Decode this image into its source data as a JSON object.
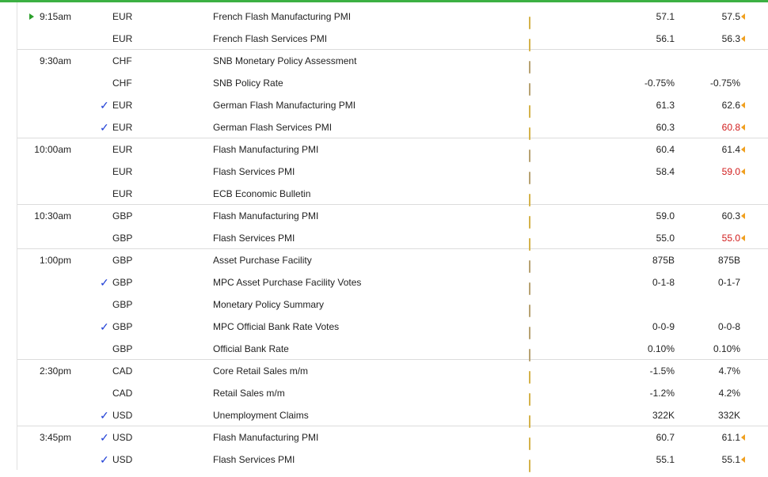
{
  "colors": {
    "accent_line": "#3cb043",
    "high_impact": "#ee1a1a",
    "medium_impact": "#f39c29",
    "low_impact": "#f3de2a",
    "worse_than_forecast": "#d11c1c",
    "check": "#1f3fd6"
  },
  "rows": [
    {
      "time": "9:15am",
      "currency": "EUR",
      "impact": "medium",
      "event": "French Flash Manufacturing PMI",
      "detail": "folder",
      "actual": "",
      "forecast": "57.1",
      "previous": "57.5",
      "previous_flag": true,
      "previous_color": "normal",
      "check": "",
      "now_marker": true,
      "group_end": false
    },
    {
      "time": "",
      "currency": "EUR",
      "impact": "medium",
      "event": "French Flash Services PMI",
      "detail": "folder",
      "actual": "",
      "forecast": "56.1",
      "previous": "56.3",
      "previous_flag": true,
      "previous_color": "normal",
      "check": "",
      "now_marker": false,
      "group_end": true
    },
    {
      "time": "9:30am",
      "currency": "CHF",
      "impact": "high",
      "event": "SNB Monetary Policy Assessment",
      "detail": "folder-open",
      "actual": "",
      "forecast": "",
      "previous": "",
      "previous_flag": false,
      "previous_color": "normal",
      "check": "",
      "now_marker": false,
      "group_end": false
    },
    {
      "time": "",
      "currency": "CHF",
      "impact": "medium",
      "event": "SNB Policy Rate",
      "detail": "folder-open",
      "actual": "",
      "forecast": "-0.75%",
      "previous": "-0.75%",
      "previous_flag": false,
      "previous_color": "normal",
      "check": "",
      "now_marker": false,
      "group_end": false
    },
    {
      "time": "",
      "currency": "EUR",
      "impact": "high",
      "event": "German Flash Manufacturing PMI",
      "detail": "folder",
      "actual": "",
      "forecast": "61.3",
      "previous": "62.6",
      "previous_flag": true,
      "previous_color": "normal",
      "check": "✓",
      "now_marker": false,
      "group_end": false
    },
    {
      "time": "",
      "currency": "EUR",
      "impact": "high",
      "event": "German Flash Services PMI",
      "detail": "folder",
      "actual": "",
      "forecast": "60.3",
      "previous": "60.8",
      "previous_flag": true,
      "previous_color": "red",
      "check": "✓",
      "now_marker": false,
      "group_end": true
    },
    {
      "time": "10:00am",
      "currency": "EUR",
      "impact": "medium",
      "event": "Flash Manufacturing PMI",
      "detail": "folder-open",
      "actual": "",
      "forecast": "60.4",
      "previous": "61.4",
      "previous_flag": true,
      "previous_color": "normal",
      "check": "",
      "now_marker": false,
      "group_end": false
    },
    {
      "time": "",
      "currency": "EUR",
      "impact": "medium",
      "event": "Flash Services PMI",
      "detail": "folder-open",
      "actual": "",
      "forecast": "58.4",
      "previous": "59.0",
      "previous_flag": true,
      "previous_color": "red",
      "check": "",
      "now_marker": false,
      "group_end": false
    },
    {
      "time": "",
      "currency": "EUR",
      "impact": "low",
      "event": "ECB Economic Bulletin",
      "detail": "folder",
      "actual": "",
      "forecast": "",
      "previous": "",
      "previous_flag": false,
      "previous_color": "normal",
      "check": "",
      "now_marker": false,
      "group_end": true
    },
    {
      "time": "10:30am",
      "currency": "GBP",
      "impact": "medium",
      "event": "Flash Manufacturing PMI",
      "detail": "folder",
      "actual": "",
      "forecast": "59.0",
      "previous": "60.3",
      "previous_flag": true,
      "previous_color": "normal",
      "check": "",
      "now_marker": false,
      "group_end": false
    },
    {
      "time": "",
      "currency": "GBP",
      "impact": "medium",
      "event": "Flash Services PMI",
      "detail": "folder",
      "actual": "",
      "forecast": "55.0",
      "previous": "55.0",
      "previous_flag": true,
      "previous_color": "red",
      "check": "",
      "now_marker": false,
      "group_end": true
    },
    {
      "time": "1:00pm",
      "currency": "GBP",
      "impact": "high",
      "event": "Asset Purchase Facility",
      "detail": "folder-open",
      "actual": "",
      "forecast": "875B",
      "previous": "875B",
      "previous_flag": false,
      "previous_color": "normal",
      "check": "",
      "now_marker": false,
      "group_end": false
    },
    {
      "time": "",
      "currency": "GBP",
      "impact": "high",
      "event": "MPC Asset Purchase Facility Votes",
      "detail": "folder-open",
      "actual": "",
      "forecast": "0-1-8",
      "previous": "0-1-7",
      "previous_flag": false,
      "previous_color": "normal",
      "check": "✓",
      "now_marker": false,
      "group_end": false
    },
    {
      "time": "",
      "currency": "GBP",
      "impact": "high",
      "event": "Monetary Policy Summary",
      "detail": "folder-open",
      "actual": "",
      "forecast": "",
      "previous": "",
      "previous_flag": false,
      "previous_color": "normal",
      "check": "",
      "now_marker": false,
      "group_end": false
    },
    {
      "time": "",
      "currency": "GBP",
      "impact": "medium",
      "event": "MPC Official Bank Rate Votes",
      "detail": "folder-open",
      "actual": "",
      "forecast": "0-0-9",
      "previous": "0-0-8",
      "previous_flag": false,
      "previous_color": "normal",
      "check": "✓",
      "now_marker": false,
      "group_end": false
    },
    {
      "time": "",
      "currency": "GBP",
      "impact": "medium",
      "event": "Official Bank Rate",
      "detail": "folder-open",
      "actual": "",
      "forecast": "0.10%",
      "previous": "0.10%",
      "previous_flag": false,
      "previous_color": "normal",
      "check": "",
      "now_marker": false,
      "group_end": true
    },
    {
      "time": "2:30pm",
      "currency": "CAD",
      "impact": "medium",
      "event": "Core Retail Sales m/m",
      "detail": "folder",
      "actual": "",
      "forecast": "-1.5%",
      "previous": "4.7%",
      "previous_flag": false,
      "previous_color": "normal",
      "check": "",
      "now_marker": false,
      "group_end": false
    },
    {
      "time": "",
      "currency": "CAD",
      "impact": "medium",
      "event": "Retail Sales m/m",
      "detail": "folder",
      "actual": "",
      "forecast": "-1.2%",
      "previous": "4.2%",
      "previous_flag": false,
      "previous_color": "normal",
      "check": "",
      "now_marker": false,
      "group_end": false
    },
    {
      "time": "",
      "currency": "USD",
      "impact": "medium",
      "event": "Unemployment Claims",
      "detail": "folder",
      "actual": "",
      "forecast": "322K",
      "previous": "332K",
      "previous_flag": false,
      "previous_color": "normal",
      "check": "✓",
      "now_marker": false,
      "group_end": true
    },
    {
      "time": "3:45pm",
      "currency": "USD",
      "impact": "medium",
      "event": "Flash Manufacturing PMI",
      "detail": "folder",
      "actual": "",
      "forecast": "60.7",
      "previous": "61.1",
      "previous_flag": true,
      "previous_color": "normal",
      "check": "✓",
      "now_marker": false,
      "group_end": false
    },
    {
      "time": "",
      "currency": "USD",
      "impact": "medium",
      "event": "Flash Services PMI",
      "detail": "folder",
      "actual": "",
      "forecast": "55.1",
      "previous": "55.1",
      "previous_flag": true,
      "previous_color": "normal",
      "check": "✓",
      "now_marker": false,
      "group_end": false
    }
  ]
}
